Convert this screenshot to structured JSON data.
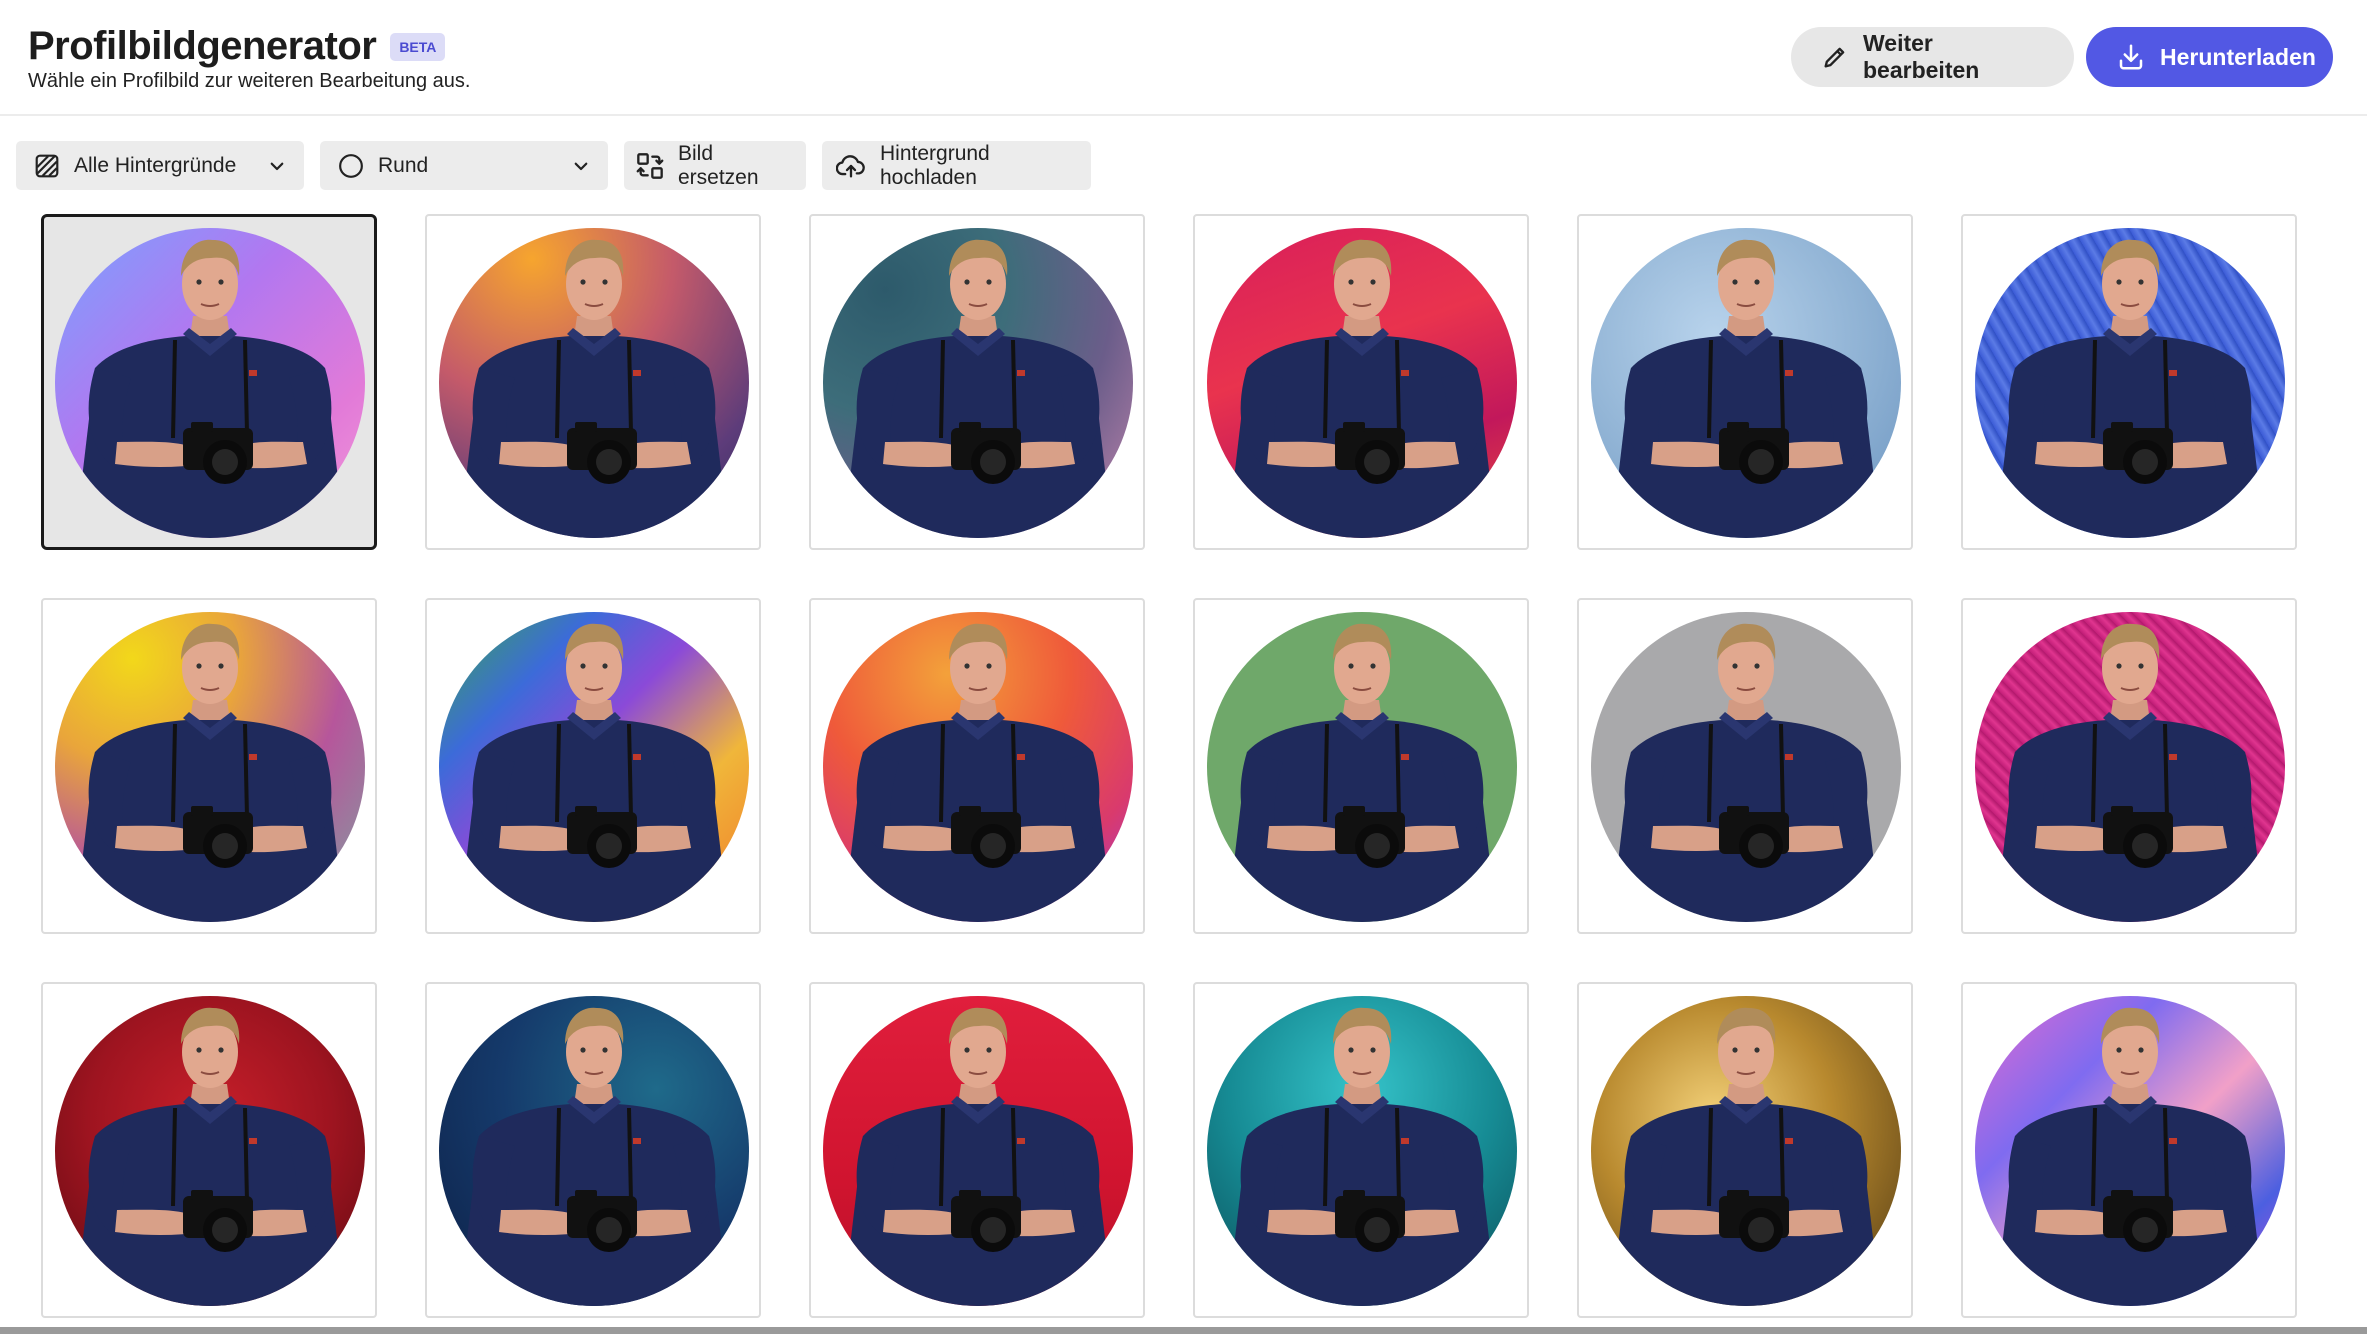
{
  "header": {
    "title": "Profilbildgenerator",
    "badge": "BETA",
    "subtitle": "Wähle ein Profilbild zur weiteren Bearbeitung aus.",
    "continue_label": "Weiter bearbeiten",
    "download_label": "Herunterladen"
  },
  "toolbar": {
    "background_filter": "Alle Hintergründe",
    "shape": "Rund",
    "replace_label": "Bild ersetzen",
    "upload_label": "Hintergrund hochladen"
  },
  "colors": {
    "accent": "#5258e4",
    "badge_bg": "#dcdcf7",
    "badge_text": "#4b4bd1"
  },
  "gallery": {
    "selected_index": 0,
    "backgrounds": [
      "purple-blue-pink-gradient",
      "orange-purple-gradient",
      "teal-pink-grain-gradient",
      "red-pink-texture",
      "soft-blue-studio",
      "blue-fabric-texture",
      "yellow-purple-teal-gradient",
      "rainbow-gradient",
      "orange-red-purple-gradient",
      "solid-green",
      "solid-gray",
      "pink-knit-texture",
      "red-glitter",
      "dark-blue-marble",
      "red-valentine-hearts",
      "teal-forest-lights",
      "gold-sequins",
      "holographic-iridescent"
    ]
  }
}
